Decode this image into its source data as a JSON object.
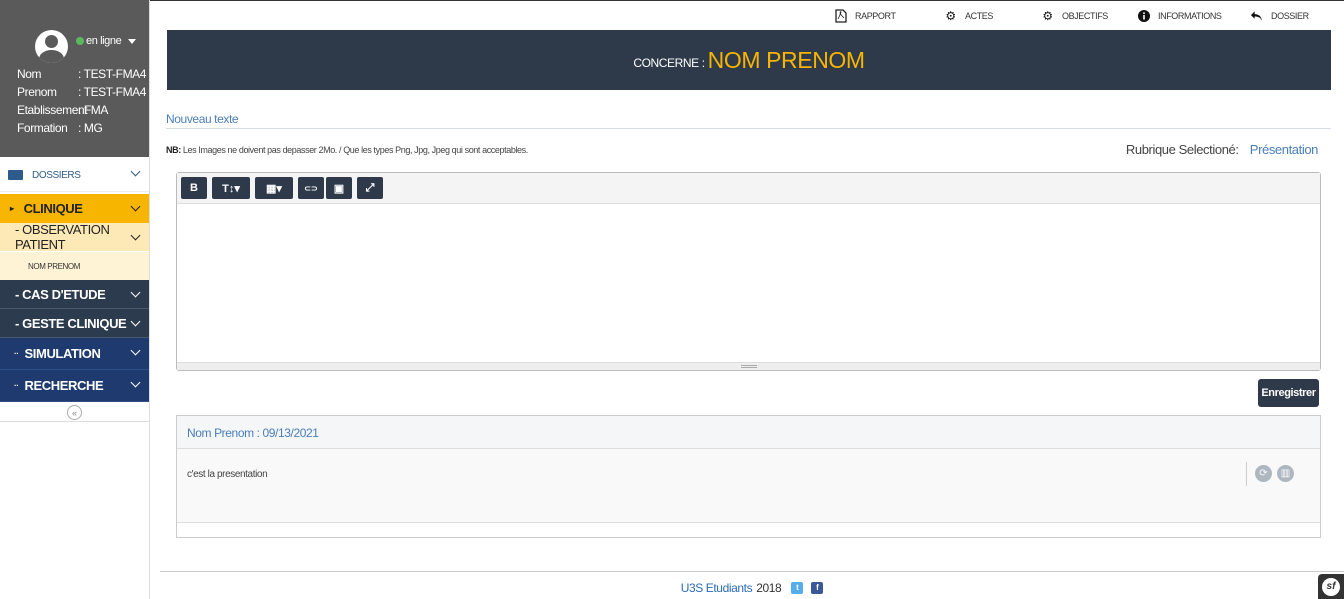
{
  "sidebar": {
    "status": "en ligne",
    "profile": [
      {
        "key": "Nom",
        "value": ": TEST-FMA4"
      },
      {
        "key": "Prenom",
        "value": ": TEST-FMA4"
      },
      {
        "key": "Etablissement",
        "value": ": FMA"
      },
      {
        "key": "Formation",
        "value": ": MG"
      }
    ],
    "dossiers": "DOSSIERS",
    "clinique": "CLINIQUE",
    "observation": "- OBSERVATION PATIENT",
    "nom_prenom": "NOM PRENOM",
    "cas": "- CAS D'ETUDE",
    "geste": "- GESTE CLINIQUE",
    "simulation": "SIMULATION",
    "recherche": "RECHERCHE"
  },
  "topnav": {
    "rapport": "RAPPORT",
    "actes": "ACTES",
    "objectifs": "OBJECTIFS",
    "informations": "INFORMATIONS",
    "dossier": "DOSSIER"
  },
  "banner": {
    "label": "CONCERNE :",
    "name": "NOM PRENOM"
  },
  "form": {
    "nouveau_texte": "Nouveau texte",
    "nb_label": "NB:",
    "nb_text": "Les Images ne doivent pas depasser 2Mo. / Que les types Png, Jpg, Jpeg qui sont acceptables.",
    "rubrique_label": "Rubrique Selectioné:",
    "rubrique_value": "Présentation",
    "save": "Enregistrer"
  },
  "toolbar": {
    "bold": "B",
    "text": "T↕▾",
    "table": "▦▾",
    "link": "⊂⊃",
    "image": "▣",
    "fullscreen": "⤢"
  },
  "entry": {
    "header": "Nom Prenom : 09/13/2021",
    "text": "c'est la presentation"
  },
  "footer": {
    "brand": "U3S Etudiants",
    "year": "2018",
    "twitter": "t",
    "facebook": "f"
  },
  "symfony": "sf"
}
